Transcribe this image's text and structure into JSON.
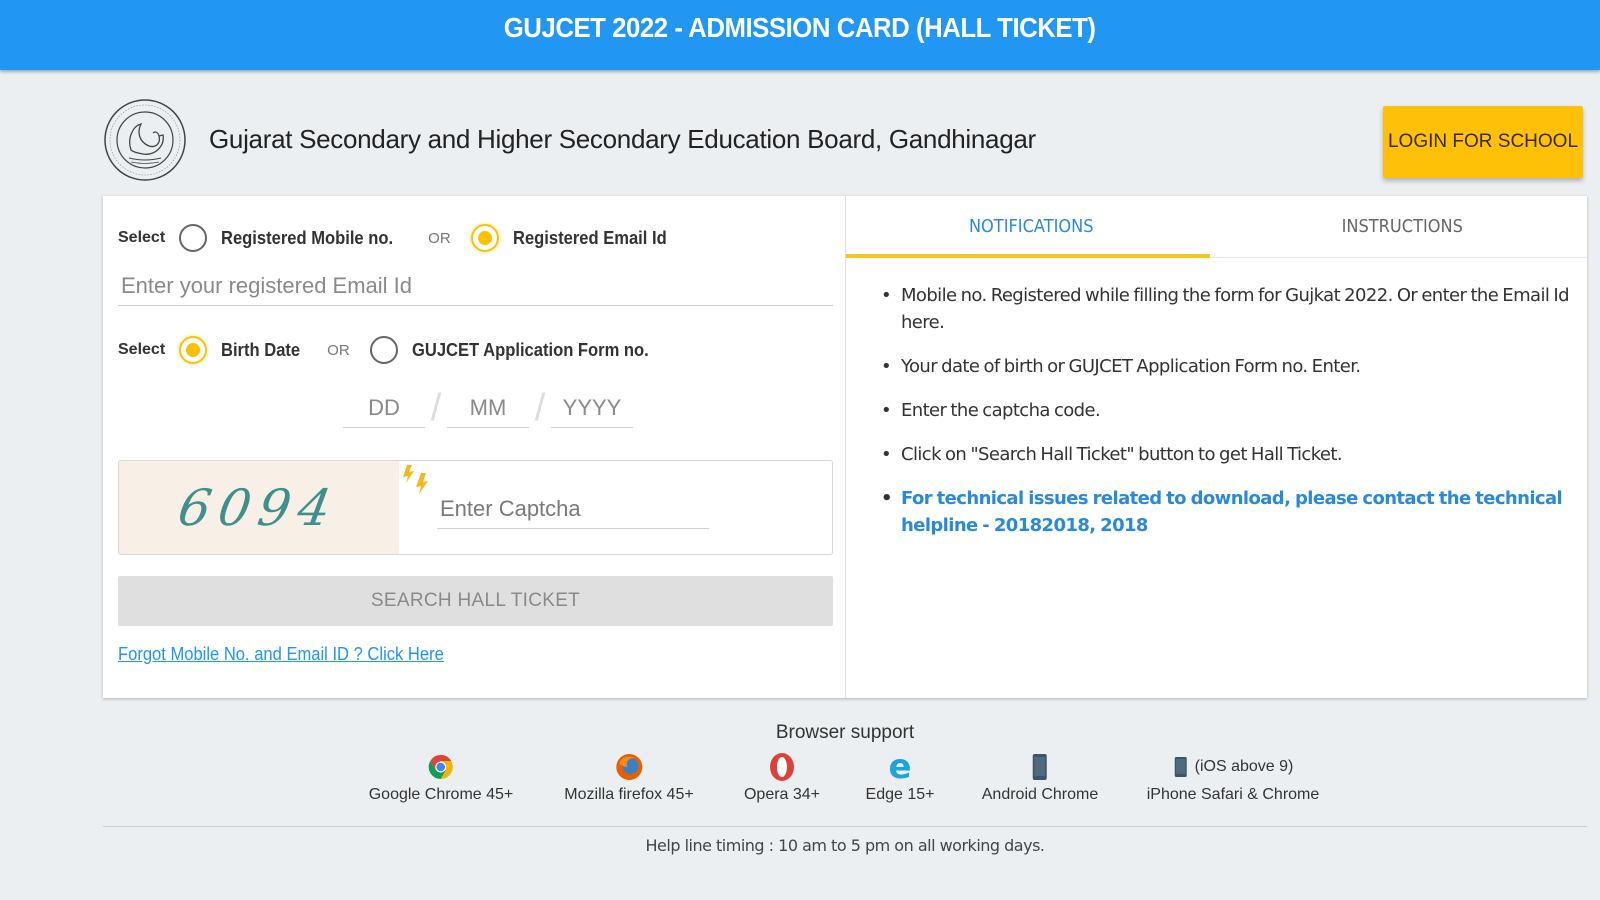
{
  "topbar": {
    "title": "GUJCET 2022 - ADMISSION CARD (HALL TICKET)"
  },
  "header": {
    "board_name": "Gujarat Secondary and Higher Secondary Education Board, Gandhinagar",
    "login_button": "LOGIN FOR SCHOOL"
  },
  "form": {
    "select_label": "Select",
    "or_label": "OR",
    "id_options": [
      {
        "label": "Registered Mobile no.",
        "selected": false
      },
      {
        "label": "Registered Email Id",
        "selected": true
      }
    ],
    "email_placeholder": "Enter your registered Email Id",
    "email_value": "",
    "auth_options": [
      {
        "label": "Birth Date",
        "selected": true
      },
      {
        "label": "GUJCET Application Form no.",
        "selected": false
      }
    ],
    "dob": {
      "dd_placeholder": "DD",
      "mm_placeholder": "MM",
      "yyyy_placeholder": "YYYY",
      "separator": "/"
    },
    "captcha": {
      "code": "6094",
      "input_placeholder": "Enter Captcha",
      "input_value": ""
    },
    "search_button": "SEARCH HALL TICKET",
    "forgot_link": "Forgot Mobile No. and Email ID ? Click Here"
  },
  "panel": {
    "tabs": [
      {
        "label": "NOTIFICATIONS",
        "active": true
      },
      {
        "label": "INSTRUCTIONS",
        "active": false
      }
    ],
    "notifications": [
      {
        "text": "Mobile no. Registered while filling the form for Gujkat 2022. Or enter the Email Id here.",
        "highlight": false
      },
      {
        "text": "Your date of birth or GUJCET Application Form no. Enter.",
        "highlight": false
      },
      {
        "text": "Enter the captcha code.",
        "highlight": false
      },
      {
        "text": "Click on \"Search Hall Ticket\" button to get Hall Ticket.",
        "highlight": false
      },
      {
        "text": "For technical issues related to download, please contact the technical helpline - 20182018, 2018",
        "highlight": true
      }
    ]
  },
  "footer": {
    "support_title": "Browser support",
    "browsers": [
      {
        "icon": "chrome-icon",
        "name": "Google Chrome 45+"
      },
      {
        "icon": "firefox-icon",
        "name": "Mozilla firefox 45+"
      },
      {
        "icon": "opera-icon",
        "name": "Opera 34+"
      },
      {
        "icon": "edge-icon",
        "name": "Edge 15+"
      },
      {
        "icon": "android-phone-icon",
        "name": "Android Chrome"
      },
      {
        "icon": "iphone-icon",
        "name": "iPhone Safari & Chrome",
        "note": "(iOS above 9)"
      }
    ],
    "helpline": "Help line timing : 10 am to 5 pm on all working days."
  },
  "colors": {
    "primary": "#2196f3",
    "accent": "#ffc107",
    "link": "#2a8ad8",
    "background": "#eceff1"
  }
}
